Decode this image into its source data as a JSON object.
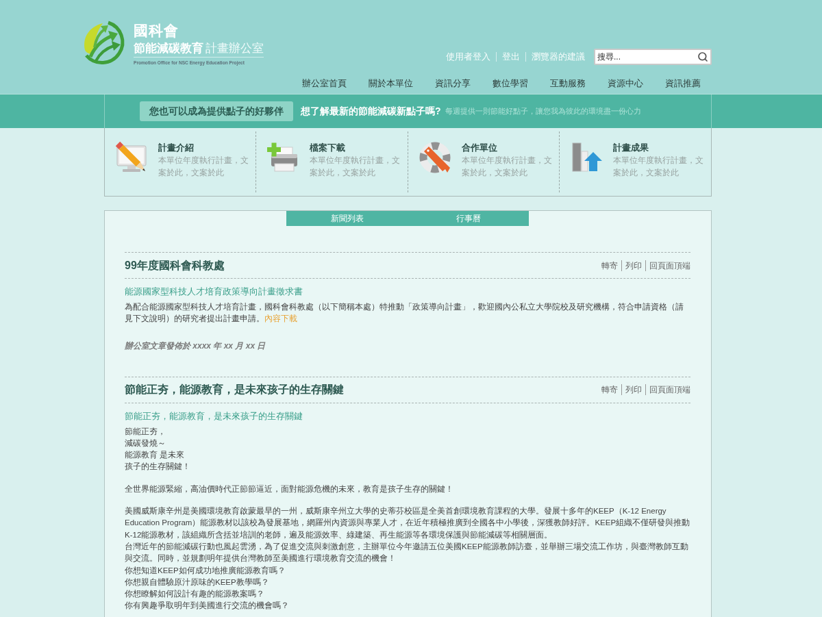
{
  "header": {
    "logo": {
      "title": "國科會",
      "subtitle_bold": "節能減碳教育",
      "subtitle_light": "計畫辦公室",
      "english": "Promotion Office for NSC Energy Education Project"
    },
    "user_links": [
      "使用者登入",
      "登出",
      "瀏覽器的建議"
    ],
    "search": {
      "placeholder": "搜尋..."
    },
    "nav": [
      "辦公室首頁",
      "關於本單位",
      "資訊分享",
      "數位學習",
      "互動服務",
      "資源中心",
      "資訊推薦"
    ]
  },
  "promo_band": {
    "button": "您也可以成為提供點子的好夥伴",
    "headline": "想了解最新的節能減碳新點子嗎?",
    "tagline": "每週提供一則節能好點子，讓您我為彼此的環境盡一份心力"
  },
  "features": [
    {
      "title": "計畫介紹",
      "description": "本單位年度執行計畫，文案於此，文案於此"
    },
    {
      "title": "檔案下載",
      "description": "本單位年度執行計畫，文案於此，文案於此"
    },
    {
      "title": "合作單位",
      "description": "本單位年度執行計畫，文案於此，文案於此"
    },
    {
      "title": "計畫成果",
      "description": "本單位年度執行計畫，文案於此，文案於此"
    }
  ],
  "tabs": [
    {
      "label": "新聞列表"
    },
    {
      "label": "行事曆"
    }
  ],
  "articles": [
    {
      "title": "99年度國科會科教處",
      "actions": [
        "轉寄",
        "列印",
        "回頁面頂端"
      ],
      "subtitle": "能源國家型科技人才培育政策導向計畫徵求書",
      "blocks": [
        [
          {
            "text": "為配合能源國家型科技人才培育計畫，國科會科教處（以下簡稱本處）特推動「政策導向計畫」，歡迎國內公私立大學院校及研究機構，符合申請資格（請見下文說明）的研究者提出計畫申請。",
            "link": "內容下載"
          }
        ]
      ],
      "byline": "辦公室文章發佈於 xxxx 年 xx 月 xx 日"
    },
    {
      "title": "節能正夯，能源教育，是未來孩子的生存關鍵",
      "actions": [
        "轉寄",
        "列印",
        "回頁面頂端"
      ],
      "subtitle": "節能正夯，能源教育，是未來孩子的生存關鍵",
      "blocks": [
        [
          {
            "text": "節能正夯，"
          },
          {
            "text": "減碳發燒～"
          },
          {
            "text": "能源教育 是未來"
          },
          {
            "text": "孩子的生存關鍵！"
          }
        ],
        [
          {
            "text": "全世界能源緊縮，高油價時代正節節逼近，面對能源危機的未來，教育是孩子生存的關鍵！"
          }
        ],
        [
          {
            "text": "美國威斯康辛州是美國環境教育啟蒙最早的一州，威斯康辛州立大學的史蒂芬校區是全美首創環境教育課程的大學。發展十多年的KEEP（K-12 Energy Education Program）能源教材以該校為發展基地，網羅州內資源與專業人才，在近年積極推廣到全國各中小學後，深獲教師好評。KEEP組織不僅研發與推動K-12能源教材，該組織所含括並培訓的老師，遍及能源效率、綠建築、再生能源等各環境保護與節能減碳等相關層面。"
          },
          {
            "text": "台灣近年的節能減碳行動也風起雲湧，為了促進交流與刺激創意，主辦單位今年邀請五位美國KEEP能源教師訪臺，並舉辦三場交流工作坊，與臺灣教師互動與交流。同時，並規劃明年提供台灣教師至美國進行環境教育交流的機會！"
          },
          {
            "text": "你想知道KEEP如何成功地推廣能源教育嗎？"
          },
          {
            "text": "你想親自體驗原汁原味的KEEP教學嗎？"
          },
          {
            "text": "你想瞭解如何設計有趣的能源教案嗎？"
          },
          {
            "text": "你有興趣爭取明年到美國進行交流的機會嗎？"
          }
        ]
      ]
    }
  ]
}
